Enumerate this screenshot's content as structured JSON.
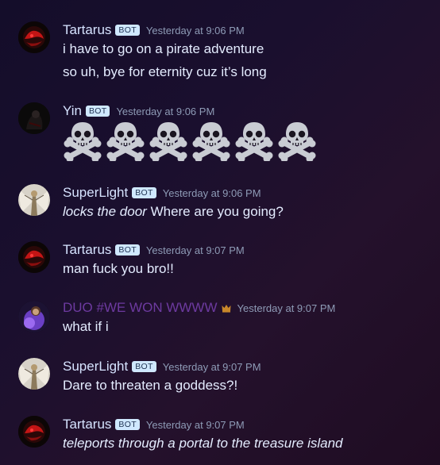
{
  "messages": [
    {
      "username": "Tartarus",
      "badge": "BOT",
      "timestamp": "Yesterday at 9:06 PM",
      "lines": [
        "i have to go on a pirate adventure",
        "so uh, bye for eternity cuz it’s long"
      ]
    },
    {
      "username": "Yin",
      "badge": "BOT",
      "timestamp": "Yesterday at 9:06 PM",
      "emoji": [
        "skull-and-crossbones",
        "skull-and-crossbones",
        "skull-and-crossbones",
        "skull-and-crossbones",
        "skull-and-crossbones",
        "skull-and-crossbones"
      ]
    },
    {
      "username": "SuperLight",
      "badge": "BOT",
      "timestamp": "Yesterday at 9:06 PM",
      "italic": "locks the door",
      "text": " Where are you going?"
    },
    {
      "username": "Tartarus",
      "badge": "BOT",
      "timestamp": "Yesterday at 9:07 PM",
      "lines": [
        "man fuck you bro!!"
      ]
    },
    {
      "username": "DUO #WE WON WWWW",
      "username_color": "#6d3aa0",
      "crown_icon": "crown-icon",
      "crown_color": "#c8872a",
      "timestamp": "Yesterday at 9:07 PM",
      "lines": [
        "what if i"
      ]
    },
    {
      "username": "SuperLight",
      "badge": "BOT",
      "timestamp": "Yesterday at 9:07 PM",
      "lines": [
        "Dare to threaten a goddess?!"
      ]
    },
    {
      "username": "Tartarus",
      "badge": "BOT",
      "timestamp": "Yesterday at 9:07 PM",
      "italic": "teleports through a portal to the treasure island"
    }
  ]
}
